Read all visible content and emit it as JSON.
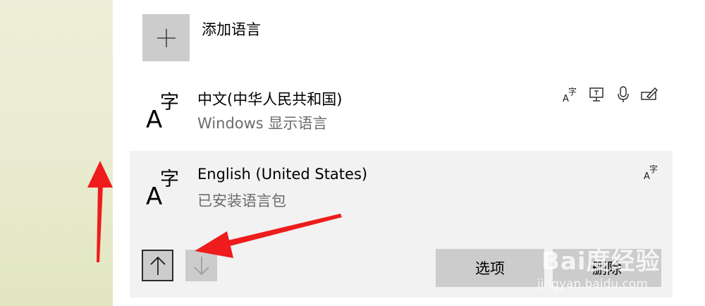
{
  "add_language": {
    "label": "添加语言",
    "icon": "plus-icon"
  },
  "languages": [
    {
      "name": "中文(中华人民共和国)",
      "subtitle": "Windows 显示语言",
      "icon": "language-character-icon",
      "features": [
        "display-language-icon",
        "text-to-speech-icon",
        "speech-recognition-icon",
        "handwriting-icon"
      ]
    },
    {
      "name": "English (United States)",
      "subtitle": "已安装语言包",
      "icon": "language-character-icon",
      "features": [
        "display-language-icon"
      ]
    }
  ],
  "actions": {
    "move_up": "↑",
    "move_down": "↓",
    "options_label": "选项",
    "remove_label": "删除"
  },
  "watermark": {
    "logo_text": "Bai度经验",
    "url": "jingyan.baidu.com"
  },
  "colors": {
    "annotation_arrow": "#ee1c1c",
    "button_bg": "#cccccc",
    "selected_bg": "#f2f2f2"
  }
}
